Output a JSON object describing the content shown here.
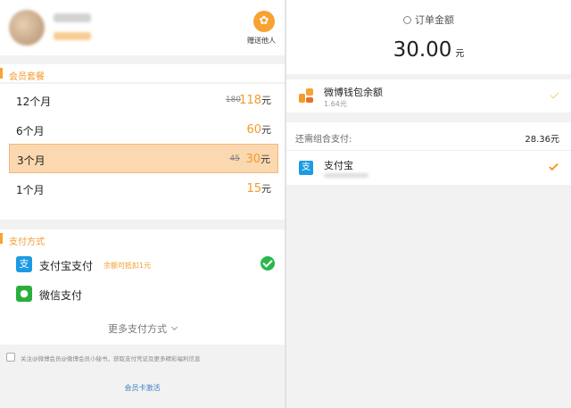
{
  "left": {
    "gift_label": "赠送他人",
    "membership_section": "会员套餐",
    "plans": [
      {
        "name": "12个月",
        "old_price": "180",
        "price": "118",
        "unit": "元",
        "selected": false
      },
      {
        "name": "6个月",
        "old_price": "",
        "price": "60",
        "unit": "元",
        "selected": false
      },
      {
        "name": "3个月",
        "old_price": "45",
        "price": "30",
        "unit": "元",
        "selected": true
      },
      {
        "name": "1个月",
        "old_price": "",
        "price": "15",
        "unit": "元",
        "selected": false
      }
    ],
    "payment_section": "支付方式",
    "payments": [
      {
        "label": "支付宝支付",
        "promo": "余额可抵扣1元",
        "checked": true
      },
      {
        "label": "微信支付",
        "promo": "",
        "checked": false
      }
    ],
    "more_methods": "更多支付方式",
    "agreement_text": "关注@微博会员@微博会员小秘书，获取支付凭证及更多精彩福利信息",
    "activate_link": "会员卡激活"
  },
  "right": {
    "order_label": "订单金额",
    "amount": "30.00",
    "currency": "元",
    "wallet": {
      "title": "微博钱包余额",
      "balance": "1.64元"
    },
    "combo_label": "还需组合支付:",
    "combo_amount": "28.36元",
    "alipay_label": "支付宝"
  },
  "colors": {
    "accent": "#f39b2b",
    "selected_bg": "#fbd8b0",
    "alipay_blue": "#1c9ae3",
    "wechat_green": "#2aae3c",
    "check_green": "#29b84a"
  }
}
